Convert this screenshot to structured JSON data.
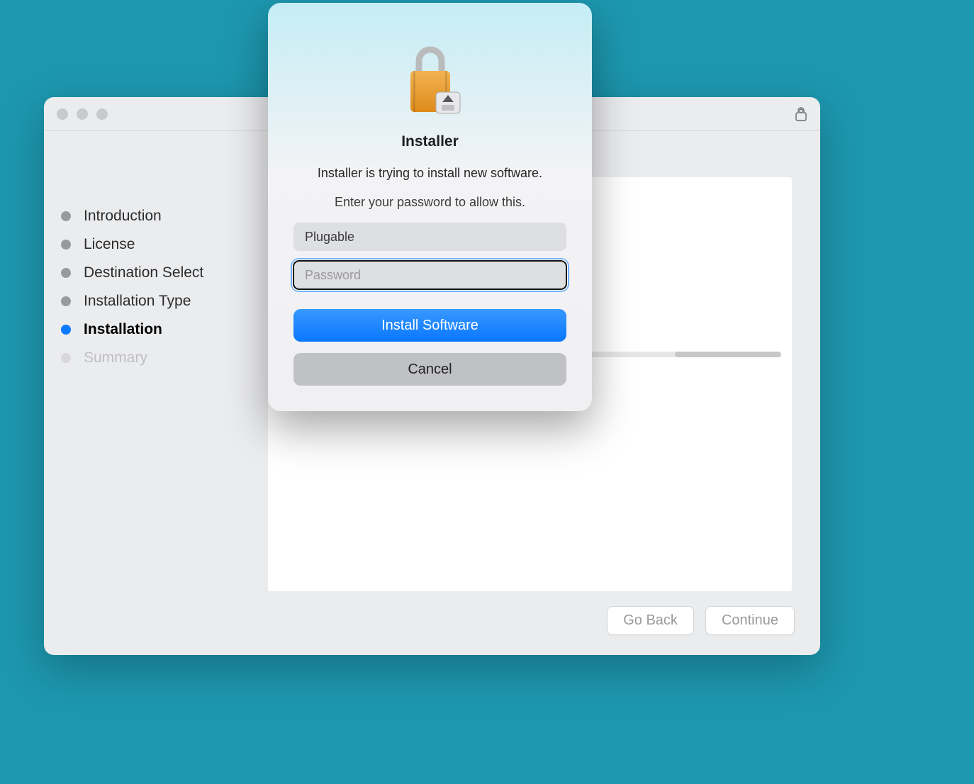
{
  "installer": {
    "steps": [
      {
        "label": "Introduction",
        "state": "past"
      },
      {
        "label": "License",
        "state": "past"
      },
      {
        "label": "Destination Select",
        "state": "past"
      },
      {
        "label": "Installation Type",
        "state": "past"
      },
      {
        "label": "Installation",
        "state": "current"
      },
      {
        "label": "Summary",
        "state": "future"
      }
    ],
    "footer": {
      "go_back": "Go Back",
      "continue": "Continue"
    }
  },
  "auth_dialog": {
    "title": "Installer",
    "message": "Installer is trying to install new software.",
    "subtext": "Enter your password to allow this.",
    "username_value": "Plugable",
    "password_placeholder": "Password",
    "install_button": "Install Software",
    "cancel_button": "Cancel"
  }
}
